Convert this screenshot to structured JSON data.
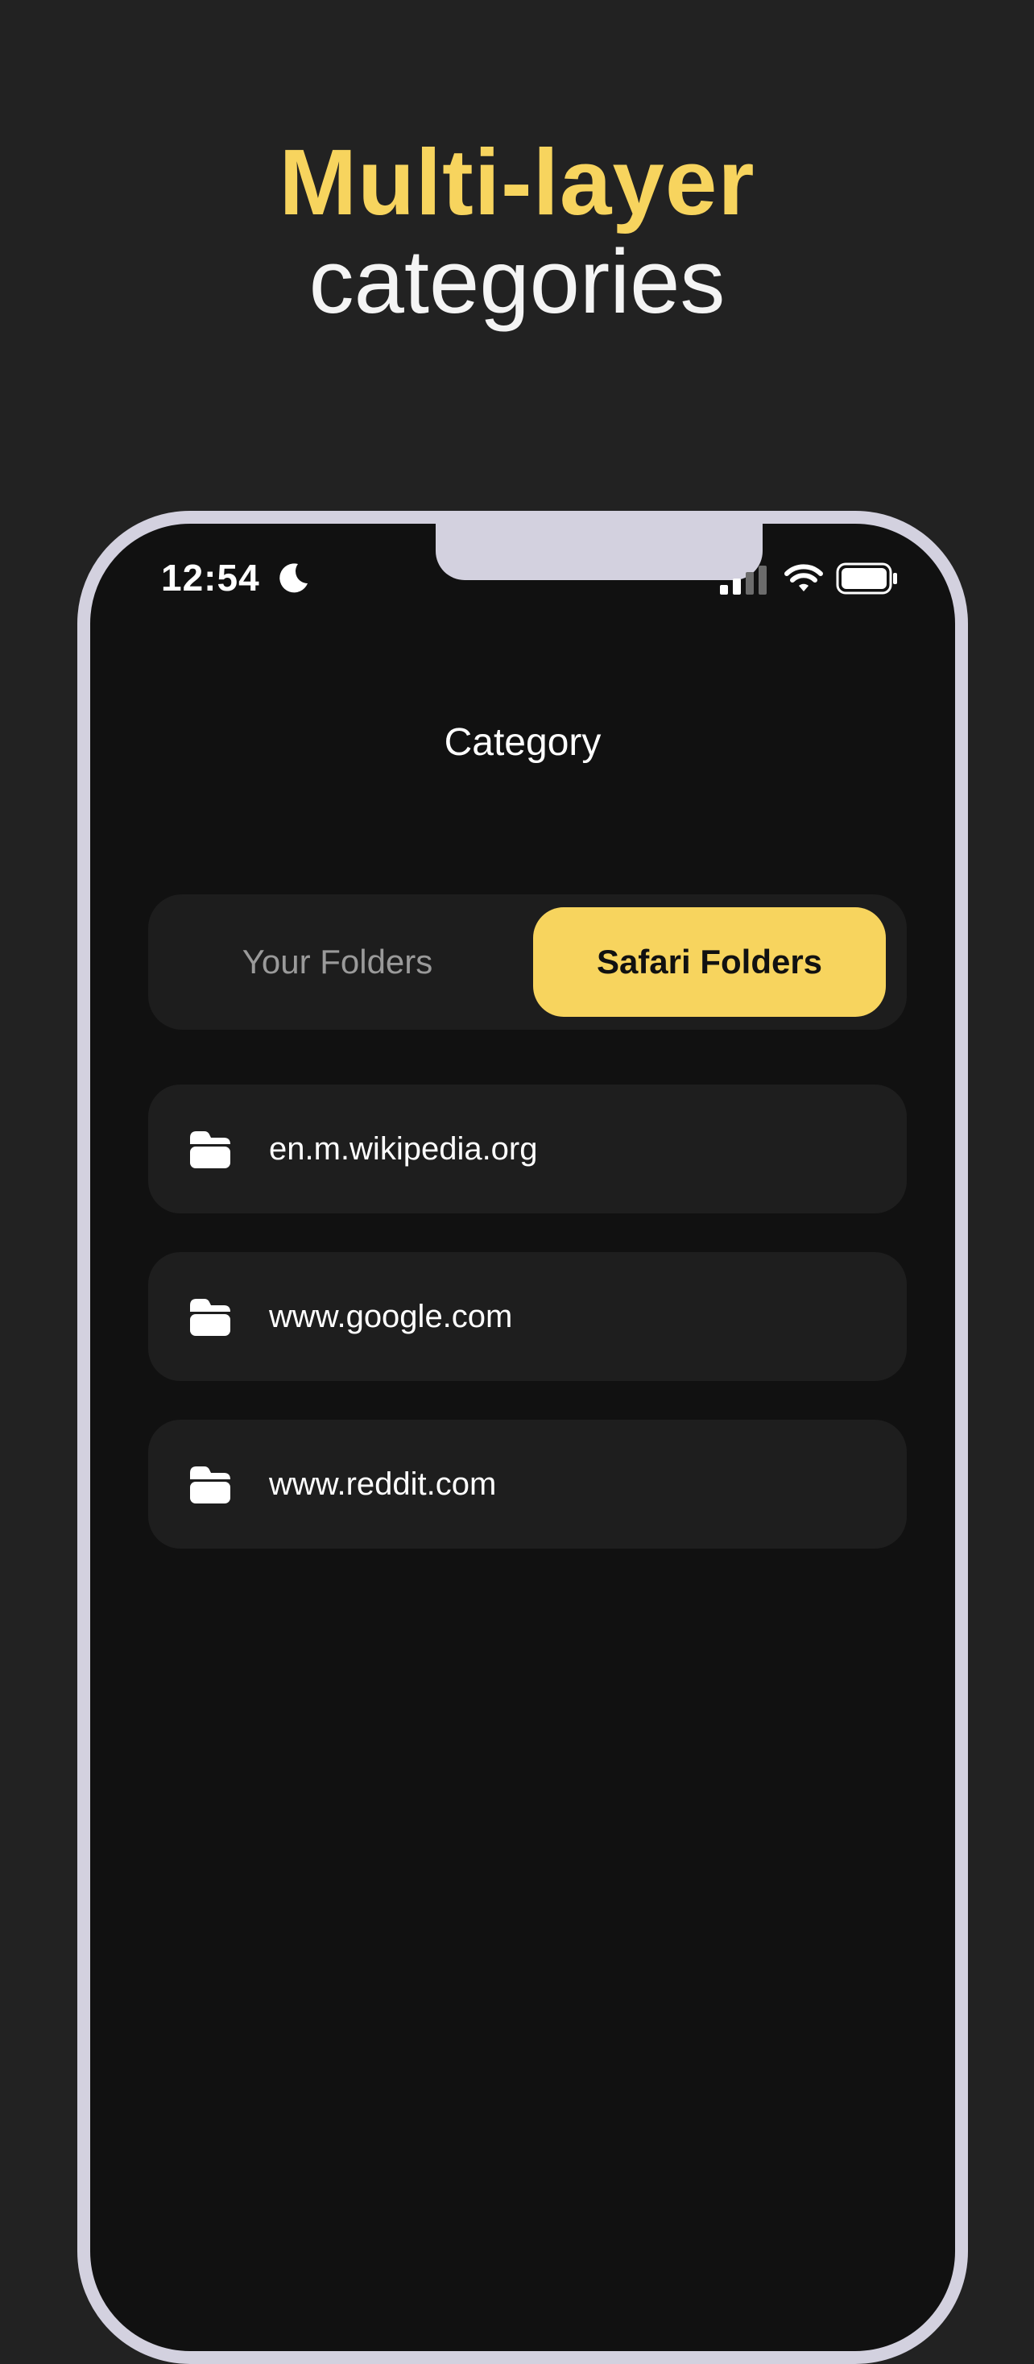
{
  "headline": {
    "accent": "Multi-layer",
    "main": "categories"
  },
  "status_bar": {
    "time": "12:54",
    "focus_icon": "moon-icon",
    "signal_icon": "cellular-signal-icon",
    "wifi_icon": "wifi-icon",
    "battery_icon": "battery-icon"
  },
  "screen": {
    "title": "Category",
    "tabs": [
      {
        "label": "Your Folders",
        "selected": false
      },
      {
        "label": "Safari Folders",
        "selected": true
      }
    ],
    "folders": [
      {
        "label": "en.m.wikipedia.org",
        "icon": "folder-icon"
      },
      {
        "label": "www.google.com",
        "icon": "folder-icon"
      },
      {
        "label": "www.reddit.com",
        "icon": "folder-icon"
      }
    ]
  },
  "colors": {
    "background": "#222222",
    "accent": "#F7D45E",
    "screen": "#111111",
    "card": "#1E1E1E",
    "frame": "#D3D1DF"
  }
}
